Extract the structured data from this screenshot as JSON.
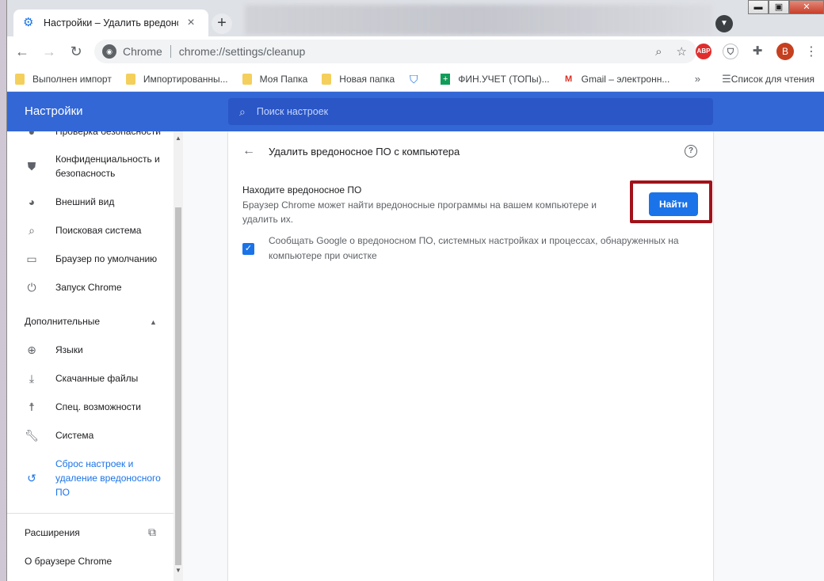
{
  "window": {
    "tab_title": "Настройки – Удалить вредонос",
    "minimize": "▬",
    "maximize": "▣",
    "close": "✕"
  },
  "toolbar": {
    "site_label": "Chrome",
    "url": "chrome://settings/cleanup",
    "avatar_letter": "B",
    "abp_label": "ABP"
  },
  "bookmarks": {
    "items": [
      {
        "label": "Выполнен импорт",
        "icon": "folder-icon"
      },
      {
        "label": "Импортированны...",
        "icon": "folder-icon"
      },
      {
        "label": "Моя Папка",
        "icon": "folder-icon"
      },
      {
        "label": "Новая папка",
        "icon": "folder-icon"
      },
      {
        "label": "",
        "icon": "shield-icon"
      },
      {
        "label": "ФИН.УЧЕТ (ТОПы)...",
        "icon": "sheets-icon"
      },
      {
        "label": "Gmail – электронн...",
        "icon": "gmail-icon"
      }
    ],
    "more": "»",
    "reading_list": "Список для чтения"
  },
  "header": {
    "title": "Настройки",
    "search_placeholder": "Поиск настроек"
  },
  "sidebar": {
    "items": [
      {
        "label": "Проверка безопасности",
        "icon": "check-shield-icon"
      },
      {
        "label": "Конфиденциальность и безопасность",
        "icon": "shield-icon"
      },
      {
        "label": "Внешний вид",
        "icon": "palette-icon"
      },
      {
        "label": "Поисковая система",
        "icon": "search-icon"
      },
      {
        "label": "Браузер по умолчанию",
        "icon": "browser-icon"
      },
      {
        "label": "Запуск Chrome",
        "icon": "power-icon"
      }
    ],
    "advanced_label": "Дополнительные",
    "advanced_items": [
      {
        "label": "Языки",
        "icon": "globe-icon"
      },
      {
        "label": "Скачанные файлы",
        "icon": "download-icon"
      },
      {
        "label": "Спец. возможности",
        "icon": "accessibility-icon"
      },
      {
        "label": "Система",
        "icon": "wrench-icon"
      },
      {
        "label": "Сброс настроек и удаление вредоносного ПО",
        "icon": "restore-icon"
      }
    ],
    "extensions": "Расширения",
    "about": "О браузере Chrome"
  },
  "cleanup": {
    "title": "Удалить вредоносное ПО с компьютера",
    "find_heading": "Находите вредоносное ПО",
    "find_description": "Браузер Chrome может найти вредоносные программы на вашем компьютере и удалить их.",
    "find_button": "Найти",
    "report_checkbox_label": "Сообщать Google о вредоносном ПО, системных настройках и процессах, обнаруженных на компьютере при очистке",
    "report_checked": true
  },
  "colors": {
    "header": "#3367d6",
    "accent": "#1a73e8",
    "highlight_box": "#a1121a"
  }
}
